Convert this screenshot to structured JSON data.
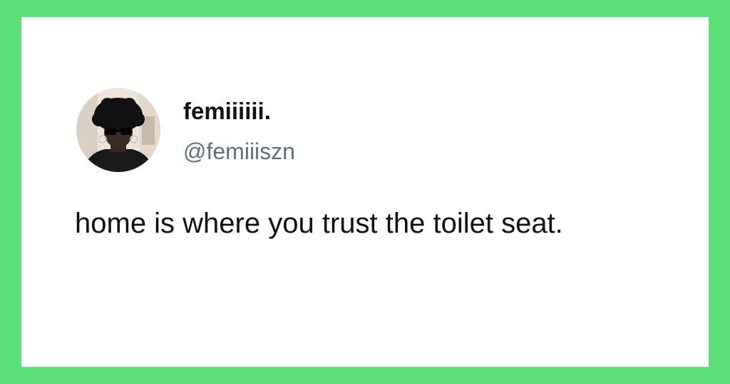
{
  "colors": {
    "frame": "#5ee07a",
    "card": "#ffffff",
    "name_text": "#111111",
    "handle_text": "#5b7083"
  },
  "tweet": {
    "avatar_icon": "profile-photo",
    "display_name": "femiiiiii.",
    "handle": "@femiiiszn",
    "text": "home is where you trust the toilet seat."
  }
}
